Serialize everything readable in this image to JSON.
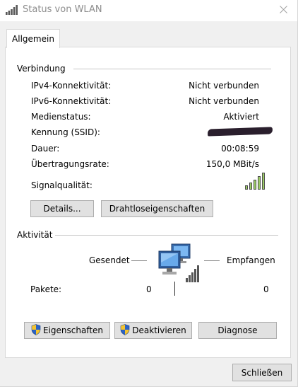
{
  "window": {
    "title": "Status von WLAN",
    "close_icon": "close-icon",
    "title_icon": "wifi-signal-icon"
  },
  "tabs": [
    {
      "label": "Allgemein",
      "selected": true
    }
  ],
  "connection": {
    "heading": "Verbindung",
    "rows": [
      {
        "label": "IPv4-Konnektivität:",
        "value": "Nicht verbunden"
      },
      {
        "label": "IPv6-Konnektivität:",
        "value": "Nicht verbunden"
      },
      {
        "label": "Medienstatus:",
        "value": "Aktiviert"
      },
      {
        "label": "Kennung (SSID):",
        "value": ""
      },
      {
        "label": "Dauer:",
        "value": "00:08:59"
      },
      {
        "label": "Übertragungsrate:",
        "value": "150,0 MBit/s"
      }
    ],
    "signal_label": "Signalqualität:",
    "signal_bars": 5,
    "signal_level": 5,
    "details_button": "Details...",
    "wireless_props_button": "Drahtloseigenschaften"
  },
  "activity": {
    "heading": "Aktivität",
    "sent_label": "Gesendet",
    "received_label": "Empfangen",
    "packets_label": "Pakete:",
    "packets_sent": "0",
    "packets_received": "0",
    "network_icon": "network-computers-icon"
  },
  "action_buttons": {
    "properties": "Eigenschaften",
    "disable": "Deaktivieren",
    "diagnose": "Diagnose",
    "shield_icon": "uac-shield-icon"
  },
  "footer": {
    "close_button": "Schließen"
  },
  "colors": {
    "button_face": "#e1e1e1",
    "button_border": "#adadad",
    "panel": "#ffffff",
    "window": "#f0f0f0",
    "title_text": "#8d8d8d"
  }
}
